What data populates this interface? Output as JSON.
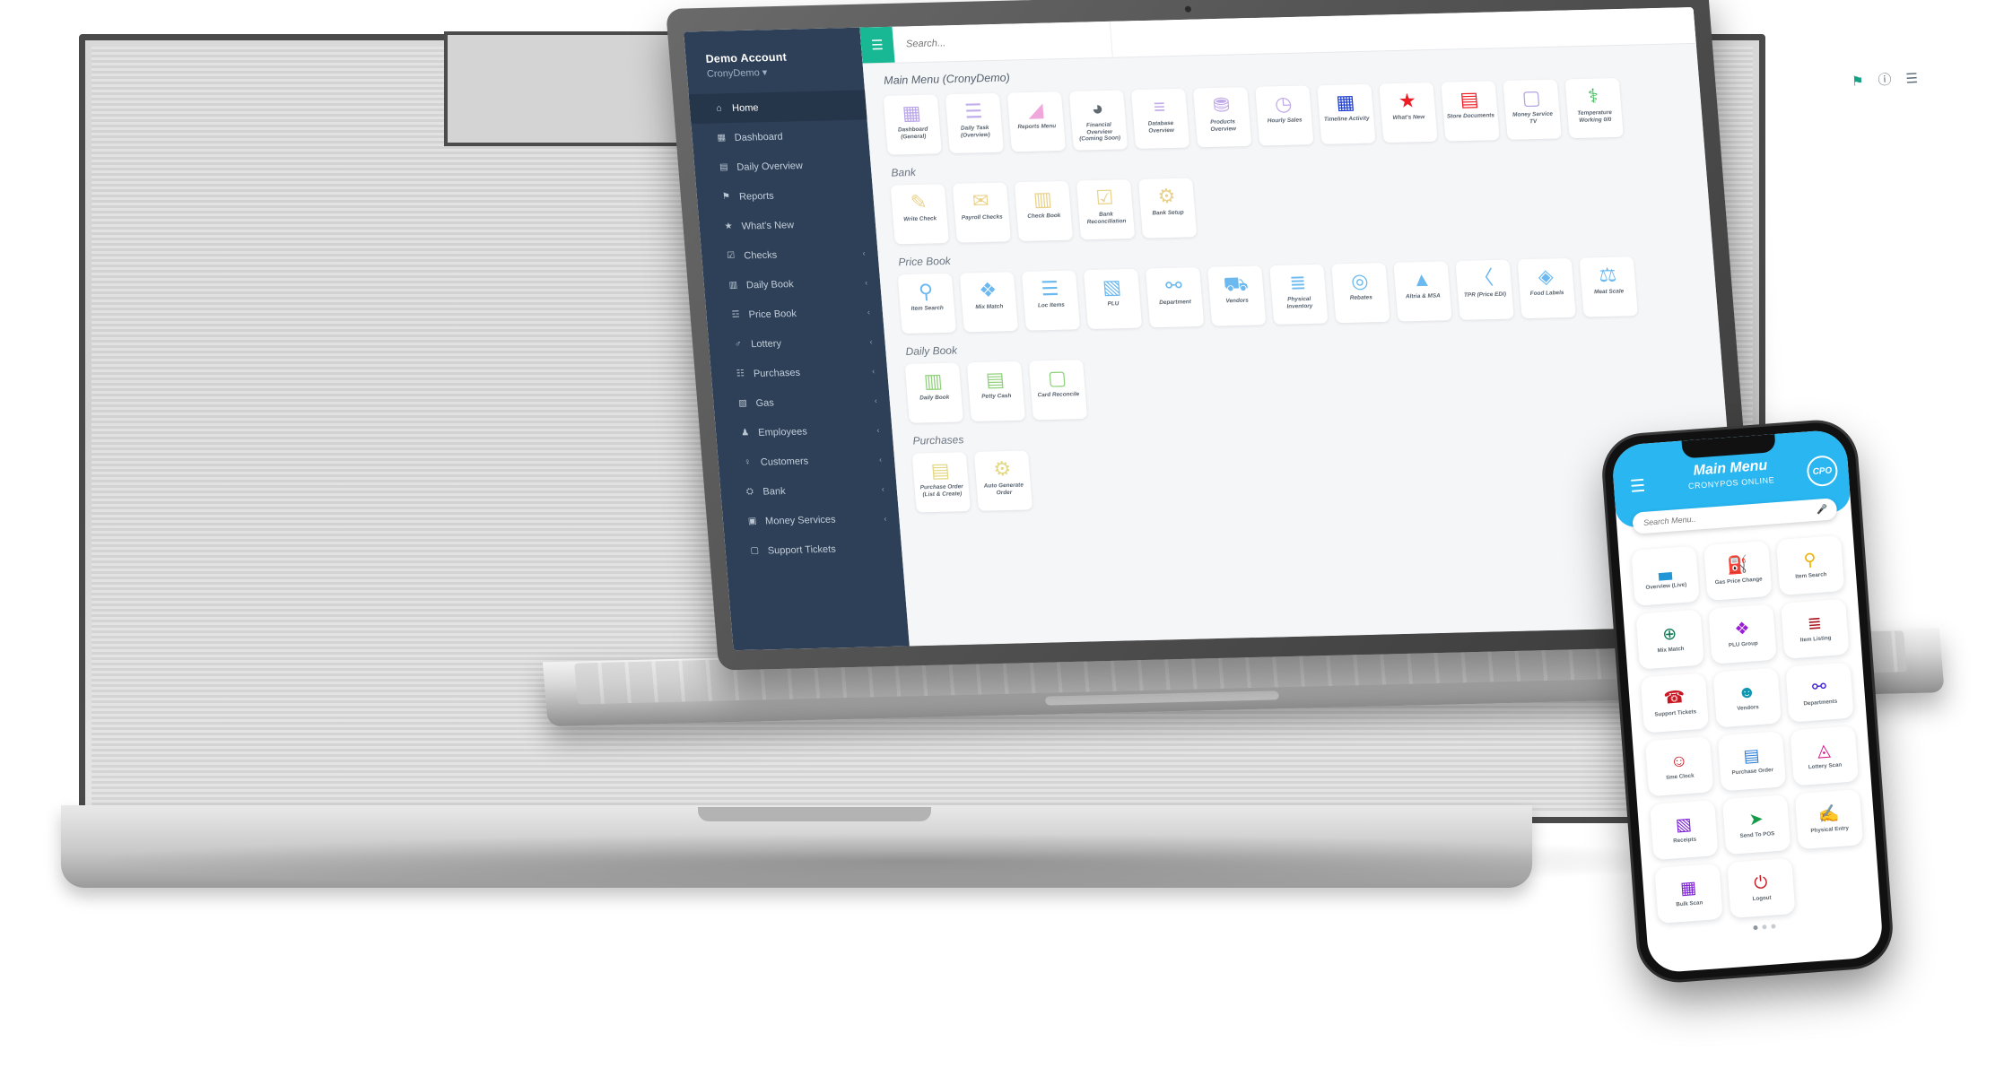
{
  "desktop_app": {
    "account": {
      "name": "Demo Account",
      "store": "CronyDemo ▾"
    },
    "topbar": {
      "menu_icon": "hamburger-icon",
      "search_placeholder": "Search..."
    },
    "page_title": "Main Menu (CronyDemo)",
    "window_icons": [
      "notification-icon",
      "help-icon",
      "menu-icon"
    ],
    "sidebar": [
      {
        "label": "Home",
        "icon": "home-icon",
        "icon_glyph": "⌂",
        "active": true,
        "caret": false
      },
      {
        "label": "Dashboard",
        "icon": "grid-icon",
        "icon_glyph": "▦",
        "active": false,
        "caret": false
      },
      {
        "label": "Daily Overview",
        "icon": "table-icon",
        "icon_glyph": "▤",
        "active": false,
        "caret": false
      },
      {
        "label": "Reports",
        "icon": "flag-icon",
        "icon_glyph": "⚑",
        "active": false,
        "caret": false
      },
      {
        "label": "What's New",
        "icon": "star-icon",
        "icon_glyph": "★",
        "active": false,
        "caret": false
      },
      {
        "label": "Checks",
        "icon": "check-icon",
        "icon_glyph": "☑",
        "active": false,
        "caret": true
      },
      {
        "label": "Daily Book",
        "icon": "book-icon",
        "icon_glyph": "▥",
        "active": false,
        "caret": true
      },
      {
        "label": "Price Book",
        "icon": "cart-icon",
        "icon_glyph": "☲",
        "active": false,
        "caret": true
      },
      {
        "label": "Lottery",
        "icon": "trophy-icon",
        "icon_glyph": "♂",
        "active": false,
        "caret": true
      },
      {
        "label": "Purchases",
        "icon": "bag-icon",
        "icon_glyph": "☷",
        "active": false,
        "caret": true
      },
      {
        "label": "Gas",
        "icon": "fuel-icon",
        "icon_glyph": "▧",
        "active": false,
        "caret": true
      },
      {
        "label": "Employees",
        "icon": "people-icon",
        "icon_glyph": "♟",
        "active": false,
        "caret": true
      },
      {
        "label": "Customers",
        "icon": "person-icon",
        "icon_glyph": "♀",
        "active": false,
        "caret": true
      },
      {
        "label": "Bank",
        "icon": "bank-icon",
        "icon_glyph": "⛭",
        "active": false,
        "caret": true
      },
      {
        "label": "Money Services",
        "icon": "money-icon",
        "icon_glyph": "▣",
        "active": false,
        "caret": true
      },
      {
        "label": "Support Tickets",
        "icon": "ticket-icon",
        "icon_glyph": "▢",
        "active": false,
        "caret": false
      }
    ],
    "sections": [
      {
        "title": "",
        "tiles": [
          {
            "label": "Dashboard (General)",
            "icon": "grid-tiles-icon",
            "glyph": "▦",
            "color": "#b9a6e8"
          },
          {
            "label": "Daily Task (Overview)",
            "icon": "task-list-icon",
            "glyph": "☰",
            "color": "#c2aeea"
          },
          {
            "label": "Reports Menu",
            "icon": "area-chart-icon",
            "glyph": "◢",
            "color": "#f0a8dc"
          },
          {
            "label": "Financial Overview (Coming Soon)",
            "icon": "pie-chart-icon",
            "glyph": "◕",
            "color": "#5f6a72"
          },
          {
            "label": "Database Overview",
            "icon": "database-icon",
            "glyph": "≡",
            "color": "#c0aae8"
          },
          {
            "label": "Products Overview",
            "icon": "basket-icon",
            "glyph": "⛃",
            "color": "#c0aae8"
          },
          {
            "label": "Hourly Sales",
            "icon": "clock-icon",
            "glyph": "◷",
            "color": "#c0aae8"
          },
          {
            "label": "Timeline Activity",
            "icon": "calendar-icon",
            "glyph": "▦",
            "color": "#1f3fd0"
          },
          {
            "label": "What's New",
            "icon": "star-icon",
            "glyph": "★",
            "color": "#ee1c25"
          },
          {
            "label": "Store Documents",
            "icon": "document-icon",
            "glyph": "▤",
            "color": "#ee1c25"
          },
          {
            "label": "Money Service TV",
            "icon": "monitor-icon",
            "glyph": "▢",
            "color": "#b3a4e0"
          },
          {
            "label": "Temperature Working 0/0",
            "icon": "thermometer-icon",
            "glyph": "⚕",
            "color": "#2db84d"
          }
        ]
      },
      {
        "title": "Bank",
        "tiles": [
          {
            "label": "Write Check",
            "icon": "pencil-icon",
            "glyph": "✎",
            "color": "#e8d28a"
          },
          {
            "label": "Payroll Checks",
            "icon": "envelope-icon",
            "glyph": "✉",
            "color": "#e8d28a"
          },
          {
            "label": "Check Book",
            "icon": "book-icon",
            "glyph": "▥",
            "color": "#e8d28a"
          },
          {
            "label": "Bank Reconciliation",
            "icon": "clipboard-icon",
            "glyph": "☑",
            "color": "#e8d28a"
          },
          {
            "label": "Bank Setup",
            "icon": "gear-icon",
            "glyph": "⚙",
            "color": "#e8d28a"
          }
        ]
      },
      {
        "title": "Price Book",
        "tiles": [
          {
            "label": "Item Search",
            "icon": "magnifier-icon",
            "glyph": "⚲",
            "color": "#6bb9ef"
          },
          {
            "label": "Mix Match",
            "icon": "puzzle-icon",
            "glyph": "❖",
            "color": "#6bb9ef"
          },
          {
            "label": "Loc Items",
            "icon": "list-icon",
            "glyph": "☰",
            "color": "#6bb9ef"
          },
          {
            "label": "PLU",
            "icon": "box-icon",
            "glyph": "▧",
            "color": "#6bb9ef"
          },
          {
            "label": "Department",
            "icon": "sitemap-icon",
            "glyph": "⚯",
            "color": "#6bb9ef"
          },
          {
            "label": "Vendors",
            "icon": "truck-icon",
            "glyph": "⛟",
            "color": "#6bb9ef"
          },
          {
            "label": "Physical Inventory",
            "icon": "checklist-icon",
            "glyph": "≣",
            "color": "#6bb9ef"
          },
          {
            "label": "Rebates",
            "icon": "coin-icon",
            "glyph": "◎",
            "color": "#6bb9ef"
          },
          {
            "label": "Altria & MSA",
            "icon": "pdf-icon",
            "glyph": "▲",
            "color": "#6bb9ef"
          },
          {
            "label": "TPR (Price EDI)",
            "icon": "code-icon",
            "glyph": "〈",
            "color": "#6bb9ef"
          },
          {
            "label": "Food Labels",
            "icon": "tags-icon",
            "glyph": "◈",
            "color": "#6bb9ef"
          },
          {
            "label": "Meat Scale",
            "icon": "scale-icon",
            "glyph": "⚖",
            "color": "#6bb9ef"
          }
        ]
      },
      {
        "title": "Daily Book",
        "tiles": [
          {
            "label": "Daily Book",
            "icon": "notebook-icon",
            "glyph": "▥",
            "color": "#8fd17a"
          },
          {
            "label": "Petty Cash",
            "icon": "wallet-icon",
            "glyph": "▤",
            "color": "#8fd17a"
          },
          {
            "label": "Card Reconcile",
            "icon": "card-icon",
            "glyph": "▢",
            "color": "#8fd17a"
          }
        ]
      },
      {
        "title": "Purchases",
        "tiles": [
          {
            "label": "Purchase Order (List & Create)",
            "icon": "invoice-icon",
            "glyph": "▤",
            "color": "#e3d884"
          },
          {
            "label": "Auto Generate Order",
            "icon": "gears-icon",
            "glyph": "⚙",
            "color": "#e3d884"
          }
        ]
      }
    ]
  },
  "mobile_app": {
    "menu_icon": "hamburger-icon",
    "title": "Main Menu",
    "subtitle": "CRONYPOS ONLINE",
    "logo_text": "CPO",
    "search_placeholder": "Search Menu..",
    "mic_icon": "microphone-icon",
    "tiles": [
      {
        "label": "Overview (Live)",
        "icon": "bar-chart-icon",
        "glyph": "▃",
        "color": "#2196d6"
      },
      {
        "label": "Gas Price Change",
        "icon": "fuel-nozzle-icon",
        "glyph": "⛽",
        "color": "#0e7e8c"
      },
      {
        "label": "Item Search",
        "icon": "magnifier-icon",
        "glyph": "⚲",
        "color": "#f0b400"
      },
      {
        "label": "Mix Match",
        "icon": "percent-badge-icon",
        "glyph": "⊕",
        "color": "#0e7a55"
      },
      {
        "label": "PLU Group",
        "icon": "boxes-icon",
        "glyph": "❖",
        "color": "#9b1fd6"
      },
      {
        "label": "Item Listing",
        "icon": "list-check-icon",
        "glyph": "≣",
        "color": "#a8131b"
      },
      {
        "label": "Support Tickets",
        "icon": "headset-icon",
        "glyph": "☎",
        "color": "#c91722"
      },
      {
        "label": "Vendors",
        "icon": "vendor-icon",
        "glyph": "☻",
        "color": "#1296b0"
      },
      {
        "label": "Departments",
        "icon": "sitemap-icon",
        "glyph": "⚯",
        "color": "#3a1fd6"
      },
      {
        "label": "time Clock",
        "icon": "user-clock-icon",
        "glyph": "☺",
        "color": "#c91722"
      },
      {
        "label": "Purchase Order",
        "icon": "order-icon",
        "glyph": "▤",
        "color": "#2f7fd6"
      },
      {
        "label": "Lottery Scan",
        "icon": "lottery-scan-icon",
        "glyph": "◬",
        "color": "#d6168a"
      },
      {
        "label": "Receipts",
        "icon": "receipt-icon",
        "glyph": "▧",
        "color": "#7a1fd6"
      },
      {
        "label": "Send To POS",
        "icon": "send-pos-icon",
        "glyph": "➤",
        "color": "#169b48"
      },
      {
        "label": "Physical Entry",
        "icon": "physical-entry-icon",
        "glyph": "✍",
        "color": "#0e9b8c"
      },
      {
        "label": "Bulk Scan",
        "icon": "bulk-scan-icon",
        "glyph": "▦",
        "color": "#7a1fd6"
      },
      {
        "label": "Logout",
        "icon": "logout-icon",
        "glyph": "⏻",
        "color": "#c91722"
      }
    ],
    "pager_dots": 3,
    "pager_active_index": 0
  }
}
